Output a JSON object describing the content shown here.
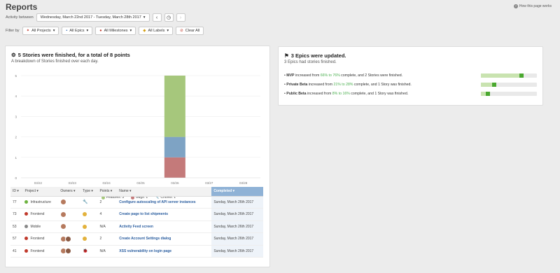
{
  "page": {
    "title": "Reports",
    "help": "How this page works"
  },
  "filters": {
    "activity_label": "Activity between",
    "date_range": "Wednesday, March 22nd 2017 - Tuesday, March 28th 2017",
    "filter_label": "Filter by",
    "projects": "All Projects",
    "epics": "All Epics",
    "milestones": "All Milestones",
    "labels": "All Labels",
    "clear": "Clear All"
  },
  "stories": {
    "title": "5 Stories were finished, for a total of 8 points",
    "subtitle": "A breakdown of Stories finished over each day.",
    "legend": {
      "features": "Features: 3",
      "bugs": "Bugs: 1",
      "chores": "Chores: 1"
    },
    "table": {
      "headers": [
        "ID",
        "Project",
        "Owners",
        "Type",
        "Points",
        "Name",
        "Completed"
      ],
      "rows": [
        {
          "id": "77",
          "project": "Infrastructure",
          "project_color": "#6db33f",
          "owners": 1,
          "type": "chore",
          "points": "2",
          "name": "Configure autoscaling of API server instances",
          "completed": "Sunday, March 26th 2017"
        },
        {
          "id": "73",
          "project": "Frontend",
          "project_color": "#c0392b",
          "owners": 1,
          "type": "feature",
          "points": "4",
          "name": "Create page to list shipments",
          "completed": "Sunday, March 26th 2017"
        },
        {
          "id": "53",
          "project": "Mobile",
          "project_color": "#888888",
          "owners": 1,
          "type": "feature",
          "points": "N/A",
          "name": "Activity Feed screen",
          "completed": "Sunday, March 26th 2017"
        },
        {
          "id": "57",
          "project": "Frontend",
          "project_color": "#c0392b",
          "owners": 2,
          "type": "feature",
          "points": "2",
          "name": "Create Account Settings dialog",
          "completed": "Sunday, March 26th 2017"
        },
        {
          "id": "41",
          "project": "Frontend",
          "project_color": "#c0392b",
          "owners": 2,
          "type": "bug",
          "points": "N/A",
          "name": "XSS vulnerability on login page",
          "completed": "Sunday, March 26th 2017"
        }
      ]
    }
  },
  "chart_data": {
    "type": "bar",
    "categories": [
      "03/22",
      "03/23",
      "03/24",
      "03/25",
      "03/26",
      "03/27",
      "03/28"
    ],
    "series": [
      {
        "name": "Features",
        "values": [
          0,
          0,
          0,
          0,
          3,
          0,
          0
        ],
        "color": "#a6c77c"
      },
      {
        "name": "Bugs",
        "values": [
          0,
          0,
          0,
          0,
          1,
          0,
          0
        ],
        "color": "#c47a7a"
      },
      {
        "name": "Chores",
        "values": [
          0,
          0,
          0,
          0,
          1,
          0,
          0
        ],
        "color": "#7ea3c4"
      }
    ],
    "stack_order": [
      "Bugs",
      "Chores",
      "Features"
    ],
    "ylim": [
      0,
      5
    ],
    "yticks": [
      "0",
      "1",
      "2",
      "3",
      "4",
      "5"
    ],
    "grid": true
  },
  "epics": {
    "title": "3 Epics were updated.",
    "subtitle": "3 Epics had stories finished.",
    "items": [
      {
        "name": "MVP",
        "from": "66%",
        "to": "76%",
        "tail": "complete, and 2 Stories were finished.",
        "from_val": 0.66,
        "to_val": 0.76
      },
      {
        "name": "Private Beta",
        "from": "21%",
        "to": "28%",
        "tail": "complete, and 1 Story was finished.",
        "from_val": 0.21,
        "to_val": 0.28
      },
      {
        "name": "Public Beta",
        "from": "8%",
        "to": "16%",
        "tail": "complete, and 1 Story was finished.",
        "from_val": 0.08,
        "to_val": 0.16
      }
    ],
    "increased_from": "increased from",
    "to_word": "to"
  }
}
